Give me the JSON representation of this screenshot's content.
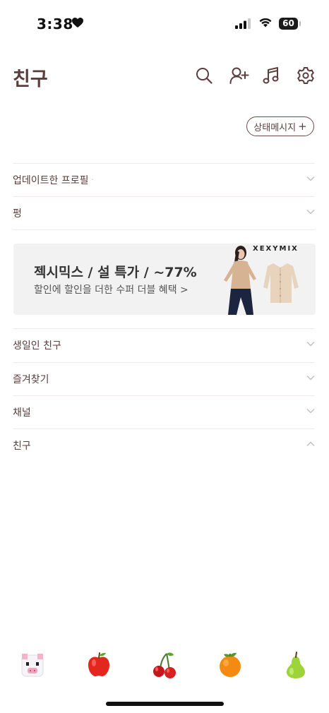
{
  "status_bar": {
    "time": "3:38",
    "battery": "60"
  },
  "header": {
    "title": "친구",
    "icons": [
      "search-icon",
      "add-friend-icon",
      "music-icon",
      "settings-icon"
    ]
  },
  "status_message_button": {
    "label": "상태메시지",
    "plus": "+"
  },
  "sections_top": [
    {
      "label": "업데이트한 프로필",
      "dot": "·"
    },
    {
      "label": "펑"
    }
  ],
  "ad": {
    "brand": "XEXYMIX",
    "title": "젝시믹스 / 설 특가 / ~77%",
    "subtitle": "할인에 할인을 더한 수퍼 더블 혜택 >"
  },
  "sections_bottom": [
    {
      "label": "생일인 친구"
    },
    {
      "label": "즐겨찾기"
    },
    {
      "label": "채널"
    },
    {
      "label": "친구"
    }
  ],
  "bottom_bar": {
    "items": [
      "pig-face-icon",
      "apple-icon",
      "cherries-icon",
      "tangerine-icon",
      "pear-icon"
    ]
  },
  "colors": {
    "text": "#5b3d3d",
    "divider": "#f0ebea",
    "ad_background": "#f2f2f2"
  }
}
